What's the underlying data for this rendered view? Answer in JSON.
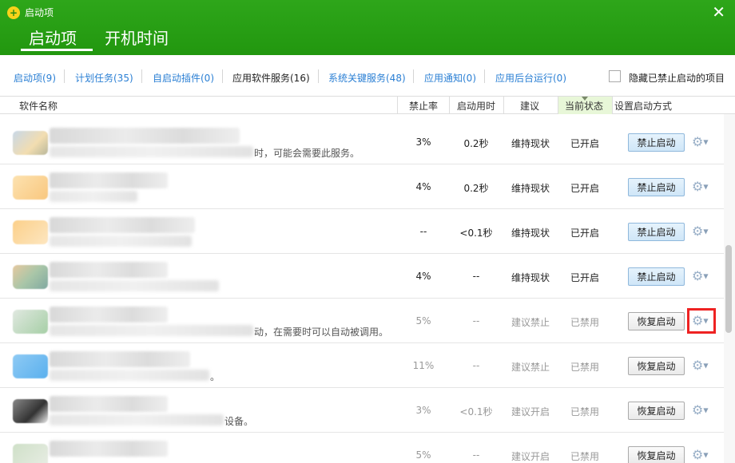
{
  "window": {
    "title": "启动项",
    "close_glyph": "✕"
  },
  "main_tabs": [
    {
      "label": "启动项",
      "active": true
    },
    {
      "label": "开机时间",
      "active": false
    }
  ],
  "sub_tabs": [
    {
      "label": "启动项(9)"
    },
    {
      "label": "计划任务(35)"
    },
    {
      "label": "自启动插件(0)"
    },
    {
      "label": "应用软件服务(16)",
      "active": true
    },
    {
      "label": "系统关键服务(48)"
    },
    {
      "label": "应用通知(0)"
    },
    {
      "label": "应用后台运行(0)"
    }
  ],
  "hide_disabled_label": "隐藏已禁止启动的项目",
  "columns": {
    "name": "软件名称",
    "rate": "禁止率",
    "time": "启动用时",
    "advice": "建议",
    "state": "当前状态",
    "action": "设置启动方式"
  },
  "rows": [
    {
      "desc_tail": "时，可能会需要此服务。",
      "rate": "3%",
      "time": "0.2秒",
      "advice": "维持现状",
      "state": "已开启",
      "action": "禁止启动",
      "enabled": true
    },
    {
      "desc_tail": "",
      "rate": "4%",
      "time": "0.2秒",
      "advice": "维持现状",
      "state": "已开启",
      "action": "禁止启动",
      "enabled": true
    },
    {
      "desc_tail": "",
      "rate": "--",
      "time": "<0.1秒",
      "advice": "维持现状",
      "state": "已开启",
      "action": "禁止启动",
      "enabled": true
    },
    {
      "desc_tail": "",
      "rate": "4%",
      "time": "--",
      "advice": "维持现状",
      "state": "已开启",
      "action": "禁止启动",
      "enabled": true
    },
    {
      "desc_tail": "动，在需要时可以自动被调用。",
      "rate": "5%",
      "time": "--",
      "advice": "建议禁止",
      "state": "已禁用",
      "action": "恢复启动",
      "enabled": false
    },
    {
      "desc_tail": "。",
      "rate": "11%",
      "time": "--",
      "advice": "建议禁止",
      "state": "已禁用",
      "action": "恢复启动",
      "enabled": false
    },
    {
      "desc_tail": "设备。",
      "rate": "3%",
      "time": "<0.1秒",
      "advice": "建议开启",
      "state": "已禁用",
      "action": "恢复启动",
      "enabled": false
    },
    {
      "desc_tail": "",
      "rate": "5%",
      "time": "--",
      "advice": "建议开启",
      "state": "已禁用",
      "action": "恢复启动",
      "enabled": false
    }
  ],
  "icon_colors": [
    "#e8d8b8",
    "#fad7a0",
    "#fbcf8a",
    "#c9d9b8",
    "#b8d8b8",
    "#8ec8f0",
    "#555555",
    "#cfe0c8"
  ]
}
